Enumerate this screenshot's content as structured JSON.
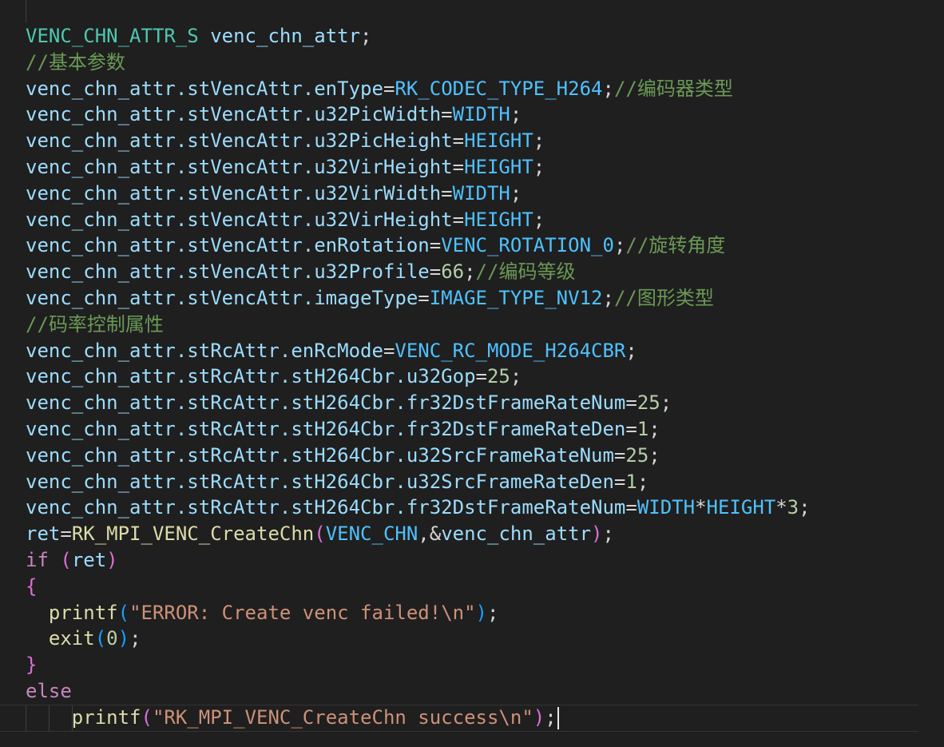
{
  "editor": {
    "colors": {
      "background": "#1f1f1f",
      "type": "#4ec9b0",
      "variable": "#9cdcfe",
      "comment": "#6a9955",
      "constant": "#4fc1ff",
      "number": "#b5cea8",
      "function": "#dcdcaa",
      "keyword": "#c586c0",
      "string": "#ce9178"
    },
    "lines": [
      {
        "tokens": [
          {
            "t": "VENC_CHN_ATTR_S",
            "c": "type"
          },
          {
            "t": " venc_chn_attr",
            "c": "var"
          },
          {
            "t": ";",
            "c": "plain"
          }
        ]
      },
      {
        "tokens": [
          {
            "t": "//基本参数",
            "c": "comment"
          }
        ]
      },
      {
        "tokens": [
          {
            "t": "venc_chn_attr.stVencAttr.enType",
            "c": "var"
          },
          {
            "t": "=",
            "c": "plain"
          },
          {
            "t": "RK_CODEC_TYPE_H264",
            "c": "const"
          },
          {
            "t": ";",
            "c": "plain"
          },
          {
            "t": "//编码器类型",
            "c": "comment"
          }
        ]
      },
      {
        "tokens": [
          {
            "t": "venc_chn_attr.stVencAttr.u32PicWidth",
            "c": "var"
          },
          {
            "t": "=",
            "c": "plain"
          },
          {
            "t": "WIDTH",
            "c": "const"
          },
          {
            "t": ";",
            "c": "plain"
          }
        ]
      },
      {
        "tokens": [
          {
            "t": "venc_chn_attr.stVencAttr.u32PicHeight",
            "c": "var"
          },
          {
            "t": "=",
            "c": "plain"
          },
          {
            "t": "HEIGHT",
            "c": "const"
          },
          {
            "t": ";",
            "c": "plain"
          }
        ]
      },
      {
        "tokens": [
          {
            "t": "venc_chn_attr.stVencAttr.u32VirHeight",
            "c": "var"
          },
          {
            "t": "=",
            "c": "plain"
          },
          {
            "t": "HEIGHT",
            "c": "const"
          },
          {
            "t": ";",
            "c": "plain"
          }
        ]
      },
      {
        "tokens": [
          {
            "t": "venc_chn_attr.stVencAttr.u32VirWidth",
            "c": "var"
          },
          {
            "t": "=",
            "c": "plain"
          },
          {
            "t": "WIDTH",
            "c": "const"
          },
          {
            "t": ";",
            "c": "plain"
          }
        ]
      },
      {
        "tokens": [
          {
            "t": "venc_chn_attr.stVencAttr.u32VirHeight",
            "c": "var"
          },
          {
            "t": "=",
            "c": "plain"
          },
          {
            "t": "HEIGHT",
            "c": "const"
          },
          {
            "t": ";",
            "c": "plain"
          }
        ]
      },
      {
        "tokens": [
          {
            "t": "venc_chn_attr.stVencAttr.enRotation",
            "c": "var"
          },
          {
            "t": "=",
            "c": "plain"
          },
          {
            "t": "VENC_ROTATION_0",
            "c": "const"
          },
          {
            "t": ";",
            "c": "plain"
          },
          {
            "t": "//旋转角度",
            "c": "comment"
          }
        ]
      },
      {
        "tokens": [
          {
            "t": "venc_chn_attr.stVencAttr.u32Profile",
            "c": "var"
          },
          {
            "t": "=",
            "c": "plain"
          },
          {
            "t": "66",
            "c": "num"
          },
          {
            "t": ";",
            "c": "plain"
          },
          {
            "t": "//编码等级",
            "c": "comment"
          }
        ]
      },
      {
        "tokens": [
          {
            "t": "venc_chn_attr.stVencAttr.imageType",
            "c": "var"
          },
          {
            "t": "=",
            "c": "plain"
          },
          {
            "t": "IMAGE_TYPE_NV12",
            "c": "const"
          },
          {
            "t": ";",
            "c": "plain"
          },
          {
            "t": "//图形类型",
            "c": "comment"
          }
        ]
      },
      {
        "tokens": [
          {
            "t": "//码率控制属性",
            "c": "comment"
          }
        ]
      },
      {
        "tokens": [
          {
            "t": "venc_chn_attr.stRcAttr.enRcMode",
            "c": "var"
          },
          {
            "t": "=",
            "c": "plain"
          },
          {
            "t": "VENC_RC_MODE_H264CBR",
            "c": "const"
          },
          {
            "t": ";",
            "c": "plain"
          }
        ]
      },
      {
        "tokens": [
          {
            "t": "venc_chn_attr.stRcAttr.stH264Cbr.u32Gop",
            "c": "var"
          },
          {
            "t": "=",
            "c": "plain"
          },
          {
            "t": "25",
            "c": "num"
          },
          {
            "t": ";",
            "c": "plain"
          }
        ]
      },
      {
        "tokens": [
          {
            "t": "venc_chn_attr.stRcAttr.stH264Cbr.fr32DstFrameRateNum",
            "c": "var"
          },
          {
            "t": "=",
            "c": "plain"
          },
          {
            "t": "25",
            "c": "num"
          },
          {
            "t": ";",
            "c": "plain"
          }
        ]
      },
      {
        "tokens": [
          {
            "t": "venc_chn_attr.stRcAttr.stH264Cbr.fr32DstFrameRateDen",
            "c": "var"
          },
          {
            "t": "=",
            "c": "plain"
          },
          {
            "t": "1",
            "c": "num"
          },
          {
            "t": ";",
            "c": "plain"
          }
        ]
      },
      {
        "tokens": [
          {
            "t": "venc_chn_attr.stRcAttr.stH264Cbr.u32SrcFrameRateNum",
            "c": "var"
          },
          {
            "t": "=",
            "c": "plain"
          },
          {
            "t": "25",
            "c": "num"
          },
          {
            "t": ";",
            "c": "plain"
          }
        ]
      },
      {
        "tokens": [
          {
            "t": "venc_chn_attr.stRcAttr.stH264Cbr.u32SrcFrameRateDen",
            "c": "var"
          },
          {
            "t": "=",
            "c": "plain"
          },
          {
            "t": "1",
            "c": "num"
          },
          {
            "t": ";",
            "c": "plain"
          }
        ]
      },
      {
        "tokens": [
          {
            "t": "venc_chn_attr.stRcAttr.stH264Cbr.fr32DstFrameRateNum",
            "c": "var"
          },
          {
            "t": "=",
            "c": "plain"
          },
          {
            "t": "WIDTH",
            "c": "const"
          },
          {
            "t": "*",
            "c": "plain"
          },
          {
            "t": "HEIGHT",
            "c": "const"
          },
          {
            "t": "*",
            "c": "plain"
          },
          {
            "t": "3",
            "c": "num"
          },
          {
            "t": ";",
            "c": "plain"
          }
        ]
      },
      {
        "tokens": [
          {
            "t": "ret",
            "c": "var"
          },
          {
            "t": "=",
            "c": "plain"
          },
          {
            "t": "RK_MPI_VENC_CreateChn",
            "c": "fn"
          },
          {
            "t": "(",
            "c": "p2"
          },
          {
            "t": "VENC_CHN",
            "c": "const"
          },
          {
            "t": ",&",
            "c": "plain"
          },
          {
            "t": "venc_chn_attr",
            "c": "var"
          },
          {
            "t": ")",
            "c": "p2"
          },
          {
            "t": ";",
            "c": "plain"
          }
        ]
      },
      {
        "tokens": [
          {
            "t": "if ",
            "c": "kw"
          },
          {
            "t": "(",
            "c": "p2"
          },
          {
            "t": "ret",
            "c": "var"
          },
          {
            "t": ")",
            "c": "p2"
          }
        ]
      },
      {
        "tokens": [
          {
            "t": "{",
            "c": "p2"
          }
        ]
      },
      {
        "tokens": [
          {
            "t": "  ",
            "c": "plain"
          },
          {
            "t": "printf",
            "c": "fn"
          },
          {
            "t": "(",
            "c": "p3"
          },
          {
            "t": "\"ERROR: Create venc failed!\\n\"",
            "c": "str"
          },
          {
            "t": ")",
            "c": "p3"
          },
          {
            "t": ";",
            "c": "plain"
          }
        ]
      },
      {
        "tokens": [
          {
            "t": "  ",
            "c": "plain"
          },
          {
            "t": "exit",
            "c": "fn"
          },
          {
            "t": "(",
            "c": "p3"
          },
          {
            "t": "0",
            "c": "num"
          },
          {
            "t": ")",
            "c": "p3"
          },
          {
            "t": ";",
            "c": "plain"
          }
        ]
      },
      {
        "tokens": [
          {
            "t": "}",
            "c": "p2"
          }
        ]
      },
      {
        "tokens": [
          {
            "t": "else",
            "c": "kw"
          }
        ]
      },
      {
        "current": true,
        "tokens": [
          {
            "t": "    ",
            "c": "plain"
          },
          {
            "t": "printf",
            "c": "fn"
          },
          {
            "t": "(",
            "c": "p2"
          },
          {
            "t": "\"RK_MPI_VENC_CreateChn success\\n\"",
            "c": "str"
          },
          {
            "t": ")",
            "c": "p2"
          },
          {
            "t": ";",
            "c": "plain"
          }
        ]
      }
    ]
  }
}
